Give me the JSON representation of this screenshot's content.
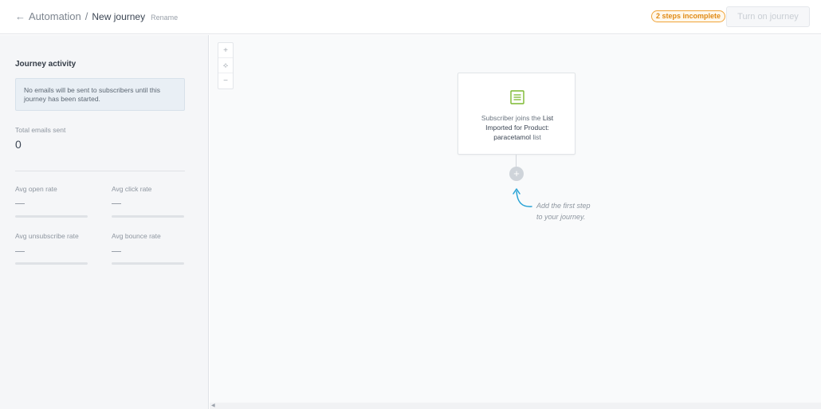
{
  "header": {
    "back_label": "Automation",
    "separator": "/",
    "current": "New journey",
    "rename_label": "Rename",
    "badge": "2 steps incomplete",
    "turn_on_label": "Turn on journey"
  },
  "sidebar": {
    "title": "Journey activity",
    "notice": "No emails will be sent to subscribers until this journey has been started.",
    "total_label": "Total emails sent",
    "total_value": "0",
    "stats": [
      {
        "label": "Avg open rate",
        "value": "—"
      },
      {
        "label": "Avg click rate",
        "value": "—"
      },
      {
        "label": "Avg unsubscribe rate",
        "value": "—"
      },
      {
        "label": "Avg bounce rate",
        "value": "—"
      }
    ]
  },
  "canvas": {
    "zoom_in": "+",
    "zoom_fit": "⟡",
    "zoom_out": "−",
    "trigger": {
      "text_prefix": "Subscriber joins the",
      "list_name": "List Imported for Product: paracetamol",
      "text_suffix": "list",
      "icon": "list-icon"
    },
    "add_step_label": "+",
    "hint_line1": "Add the first step",
    "hint_line2": "to your journey."
  },
  "colors": {
    "accent_green": "#7cb82f",
    "hint_arrow": "#29a3d6",
    "badge_orange": "#e08a14"
  }
}
